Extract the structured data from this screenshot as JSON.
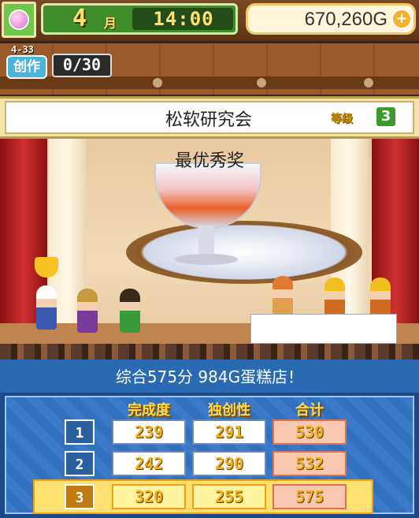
{
  "hud": {
    "month": "4",
    "month_unit": "月",
    "time": "14:00",
    "gold": "670,260G",
    "plus_label": "+"
  },
  "create": {
    "date": "4-33",
    "label": "创作",
    "count": "0/30"
  },
  "contest": {
    "name": "松软研究会",
    "level_label": "等级",
    "level": "3",
    "award": "最优秀奖"
  },
  "summary": "综合575分 984G蛋糕店！",
  "scores": {
    "headers": [
      "完成度",
      "独创性",
      "合计"
    ],
    "rows": [
      {
        "num": "1",
        "values": [
          "239",
          "291",
          "530"
        ]
      },
      {
        "num": "2",
        "values": [
          "242",
          "290",
          "532"
        ]
      },
      {
        "num": "3",
        "values": [
          "320",
          "255",
          "575"
        ]
      }
    ]
  },
  "colors": {
    "hud_green": "#3f8d2a",
    "score_blue": "#2a6ab2",
    "score_gold": "#ffd84a"
  }
}
